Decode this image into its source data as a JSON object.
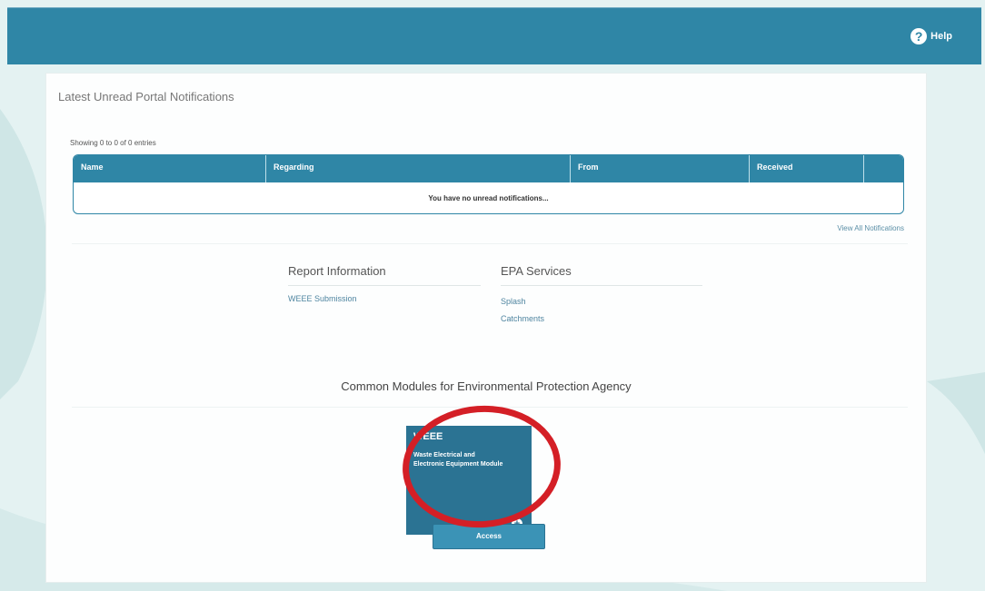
{
  "header": {
    "help_label": "Help",
    "help_icon": "question-circle-icon",
    "bar_color": "#2f86a6"
  },
  "notifications": {
    "title": "Latest Unread Portal Notifications",
    "entries_info": "Showing 0 to 0 of 0 entries",
    "columns": [
      "Name",
      "Regarding",
      "From",
      "Received",
      ""
    ],
    "empty_message": "You have no unread notifications...",
    "view_all_label": "View All Notifications"
  },
  "report_information": {
    "heading": "Report Information",
    "links": [
      "WEEE Submission"
    ]
  },
  "epa_services": {
    "heading": "EPA Services",
    "links": [
      "Splash",
      "Catchments"
    ]
  },
  "modules": {
    "title": "Common Modules for Environmental Protection Agency",
    "tile": {
      "name": "WEEE",
      "description": "Waste Electrical and Electronic Equipment Module",
      "plus_icon": "plus-circle-icon",
      "color": "#2b7393"
    },
    "access_button_label": "Access",
    "highlight_color": "#d41f26"
  }
}
